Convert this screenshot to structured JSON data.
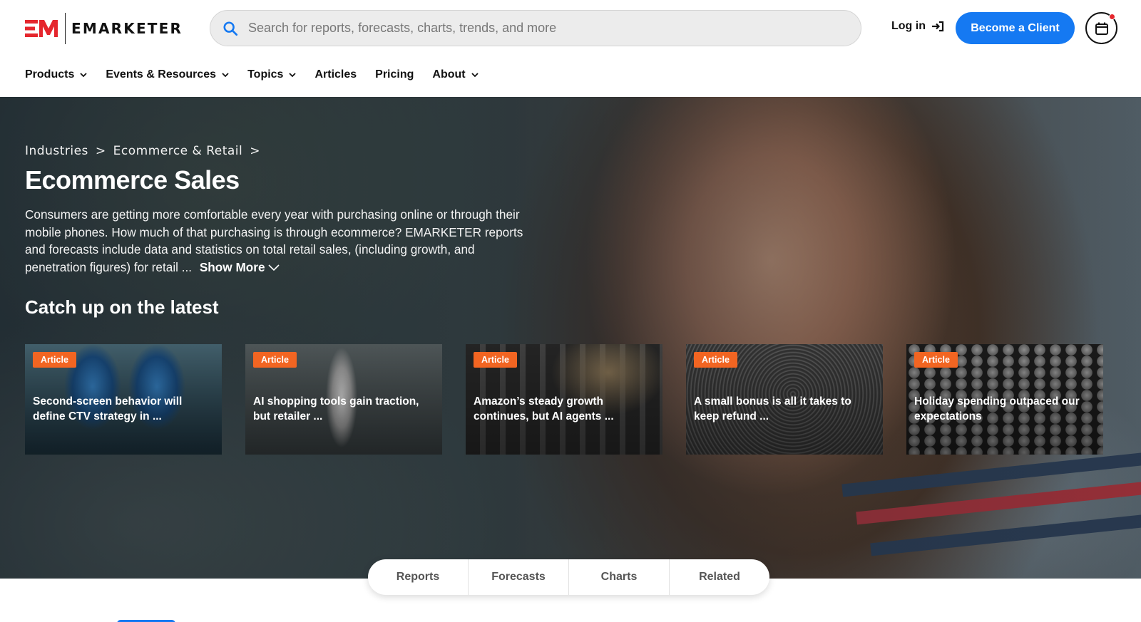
{
  "brand": {
    "name": "EMARKETER",
    "mark": "EM",
    "accent": "#e5262d"
  },
  "search": {
    "placeholder": "Search for reports, forecasts, charts, trends, and more"
  },
  "header": {
    "login_label": "Log in",
    "cta_label": "Become a Client",
    "cta_color": "#1579f2"
  },
  "nav": {
    "items": [
      {
        "label": "Products",
        "has_menu": true
      },
      {
        "label": "Events & Resources",
        "has_menu": true
      },
      {
        "label": "Topics",
        "has_menu": true
      },
      {
        "label": "Articles",
        "has_menu": false
      },
      {
        "label": "Pricing",
        "has_menu": false
      },
      {
        "label": "About",
        "has_menu": true
      }
    ]
  },
  "hero": {
    "breadcrumb": [
      "Industries",
      ">",
      "Ecommerce & Retail",
      ">"
    ],
    "title": "Ecommerce Sales",
    "description": "Consumers are getting more comfortable every year with purchasing online or through their mobile phones. How much of that purchasing is through ecommerce? EMARKETER reports and forecasts include data and statistics on total retail sales, (including growth, and penetration figures) for retail ...",
    "show_more": "Show More",
    "section_title": "Catch up on the latest"
  },
  "cards": [
    {
      "badge": "Article",
      "title": "Second-screen behavior will define CTV strategy in ..."
    },
    {
      "badge": "Article",
      "title": "AI shopping tools gain traction, but retailer ..."
    },
    {
      "badge": "Article",
      "title": "Amazon’s steady growth continues, but AI agents ..."
    },
    {
      "badge": "Article",
      "title": "A small bonus is all it takes to keep refund ..."
    },
    {
      "badge": "Article",
      "title": "Holiday spending outpaced our expectations"
    }
  ],
  "tabs": [
    "Reports",
    "Forecasts",
    "Charts",
    "Related"
  ],
  "colors": {
    "badge": "#f26522",
    "primary": "#1579f2"
  }
}
